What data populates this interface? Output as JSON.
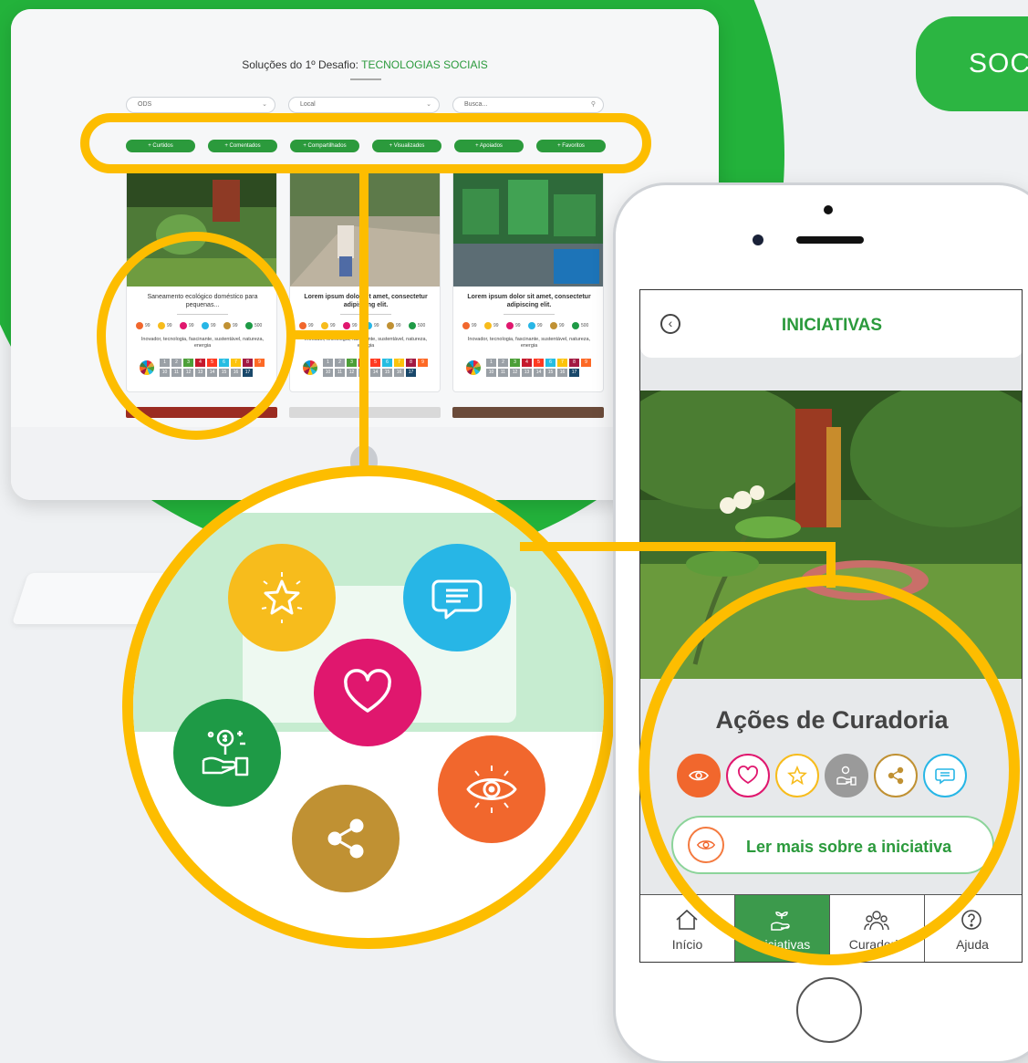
{
  "banner": {
    "label": "SOC"
  },
  "desktop": {
    "title_prefix": "Soluções do 1º Desafio: ",
    "title_highlight": "TECNOLOGIAS SOCIAIS",
    "filters": [
      {
        "label": "ODS"
      },
      {
        "label": "Local"
      },
      {
        "label": "Busca..."
      }
    ],
    "sort_chips": [
      "+ Curtidos",
      "+ Comentados",
      "+ Compartilhados",
      "+ Visualizados",
      "+ Apoiados",
      "+ Favoritos"
    ],
    "cards": [
      {
        "title": "Saneamento ecológico doméstico para pequenas...",
        "tags": "Inovador, tecnologia, fascinante, sustentável, natureza, energia",
        "counts": [
          "99",
          "99",
          "99",
          "99",
          "99",
          "500"
        ]
      },
      {
        "title": "Lorem ipsum dolor sit amet, consectetur adipiscing elit.",
        "tags": "Inovador, tecnologia, fascinante, sustentável, natureza, energia",
        "counts": [
          "99",
          "99",
          "99",
          "99",
          "99",
          "500"
        ]
      },
      {
        "title": "Lorem ipsum dolor sit amet, consectetur adipiscing elit.",
        "tags": "Inovador, tecnologia, fascinante, sustentável, natureza, energia",
        "counts": [
          "99",
          "99",
          "99",
          "99",
          "99",
          "500"
        ]
      }
    ],
    "ods_numbers": [
      "1",
      "2",
      "3",
      "4",
      "5",
      "6",
      "7",
      "8",
      "9",
      "10",
      "11",
      "12",
      "13",
      "14",
      "15",
      "16",
      "17"
    ]
  },
  "zoom_icons": [
    "star-icon",
    "comment-icon",
    "heart-icon",
    "support-money-icon",
    "eye-icon",
    "share-icon"
  ],
  "phone": {
    "header_title": "INICIATIVAS",
    "section_title": "Ações de Curadoria",
    "actions": [
      "eye-icon",
      "heart-icon",
      "star-icon",
      "support-money-icon",
      "share-icon",
      "comment-icon"
    ],
    "read_more": "Ler mais sobre a iniciativa",
    "tabs": [
      {
        "label": "Início",
        "icon": "home-icon"
      },
      {
        "label": "Iniciativas",
        "icon": "hand-plant-icon",
        "active": true
      },
      {
        "label": "Curadoria",
        "icon": "people-icon"
      },
      {
        "label": "Ajuda",
        "icon": "help-icon"
      }
    ]
  },
  "colors": {
    "green": "#23b23b",
    "highlight": "#fdbd00",
    "star": "#f7bc1c",
    "comment": "#27b6e6",
    "heart": "#e0176e",
    "money": "#1e9a46",
    "eye": "#f1672d",
    "share": "#c09133"
  }
}
